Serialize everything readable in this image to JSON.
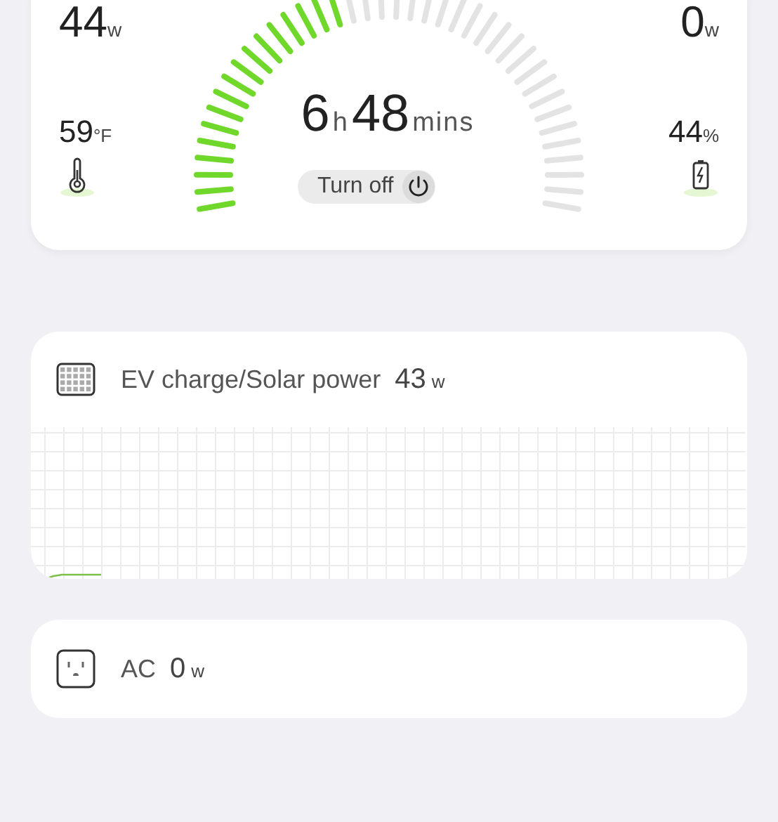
{
  "status": {
    "input": {
      "value": "44",
      "unit": "w"
    },
    "output": {
      "value": "0",
      "unit": "w"
    },
    "temperature": {
      "value": "59",
      "unit": "°F"
    },
    "battery": {
      "value": "44",
      "unit": "%"
    },
    "runtime": {
      "hours": "6",
      "hours_unit": "h",
      "minutes": "48",
      "minutes_unit": "mins"
    },
    "power_button": {
      "label": "Turn off"
    }
  },
  "panels": [
    {
      "kind": "solar",
      "title": "EV charge/Solar power",
      "value": "43",
      "unit": "w"
    },
    {
      "kind": "ac",
      "title": "AC",
      "value": "0",
      "unit": "w"
    }
  ]
}
